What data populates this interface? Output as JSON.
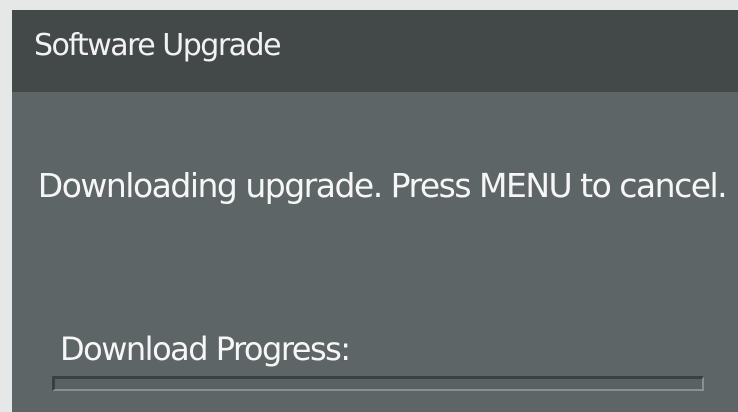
{
  "dialog": {
    "title": "Software Upgrade",
    "message": "Downloading upgrade. Press MENU to cancel.",
    "progress_label": "Download Progress:",
    "progress_fraction": 0
  }
}
